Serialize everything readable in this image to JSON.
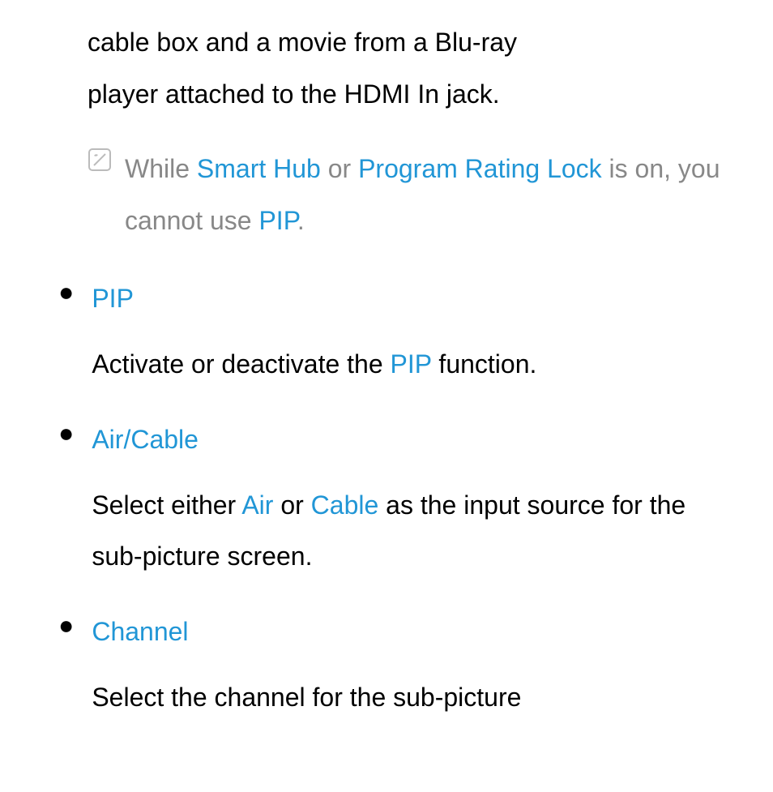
{
  "intro": {
    "line1": "cable box and a movie from a Blu-ray",
    "line2": "player attached to the HDMI In jack."
  },
  "note": {
    "prefix": "While ",
    "link1": "Smart Hub",
    "mid1": " or ",
    "link2": "Program Rating Lock",
    "mid2": " is on, you cannot use ",
    "link3": "PIP",
    "suffix": "."
  },
  "items": [
    {
      "title": "PIP",
      "body_prefix": "Activate or deactivate the ",
      "body_link": "PIP",
      "body_suffix": " function."
    },
    {
      "title": "Air/Cable",
      "body_prefix": "Select either ",
      "body_link1": "Air",
      "body_mid": " or ",
      "body_link2": "Cable",
      "body_suffix": " as the input source for the sub-picture screen."
    },
    {
      "title": "Channel",
      "body_prefix": "Select the channel for the sub-picture"
    }
  ]
}
